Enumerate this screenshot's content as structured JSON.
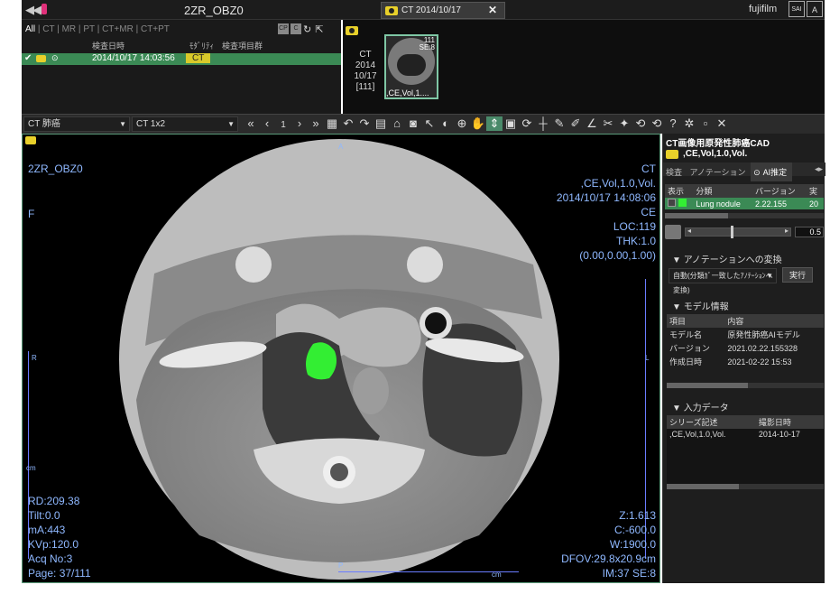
{
  "topbar": {
    "patient_id": "2ZR_OBZ0",
    "study_tab": "CT 2014/10/17",
    "close_glyph": "✕",
    "user": "fujifilm",
    "icon1": "SAI",
    "icon2": "A"
  },
  "study_list": {
    "filters": [
      "All",
      "CT",
      "MR",
      "PT",
      "CT+MR",
      "CT+PT"
    ],
    "headers": {
      "date": "検査日時",
      "modality": "ﾓﾀﾞﾘﾃｨ",
      "exam": "検査項目群"
    },
    "row": {
      "date": "2014/10/17 14:03:56",
      "modality": "CT"
    }
  },
  "series": {
    "info_lines": [
      "CT",
      "2014",
      "10/17",
      "[111]"
    ],
    "thumb_count": "111",
    "thumb_se": "SE:8",
    "thumb_caption": ",CE,Vol,1...."
  },
  "toolbar": {
    "preset": "CT 肺癌",
    "layout": "CT 1x2",
    "page": "1"
  },
  "viewer": {
    "left_top": [
      "2ZR_OBZ0"
    ],
    "left_mid": "F",
    "left_r": "R",
    "left_cm": "cm",
    "top_marker": "A",
    "bottom_marker": "P",
    "right_marker": "L",
    "scale_cm": "cm",
    "right_top": [
      "CT",
      ",CE,Vol,1.0,Vol.",
      "2014/10/17 14:08:06",
      "CE",
      "LOC:119",
      "THK:1.0",
      "(0.00,0.00,1.00)"
    ],
    "left_bottom": [
      "RD:209.38",
      "Tilt:0.0",
      "mA:443",
      "KVp:120.0",
      "Acq No:3",
      "Page: 37/111"
    ],
    "right_bottom": [
      "Z:1.613",
      "C:-600.0",
      "W:1900.0",
      "DFOV:29.8x20.9cm",
      "IM:37 SE:8"
    ]
  },
  "cad_panel": {
    "title": "CT画像用原発性肺癌CAD",
    "series": ",CE,Vol,1.0,Vol.",
    "tabs": [
      "検査",
      "アノテーション",
      "AI推定"
    ],
    "result_headers": [
      "表示",
      "分類",
      "バージョン",
      "実"
    ],
    "result_row": {
      "label": "Lung nodule",
      "version": "2.22.155",
      "extra": "20"
    },
    "threshold": "0.5",
    "annotation_section": "アノテーションへの変換",
    "annotation_option": "自動(分類ｶﾞ一致したｱﾉﾃｰｼｮﾝへ変換)",
    "run_button": "実行",
    "model_section": "モデル情報",
    "model_headers": [
      "項目",
      "内容"
    ],
    "model_rows": [
      {
        "k": "モデル名",
        "v": "原発性肺癌AIモデル"
      },
      {
        "k": "バージョン",
        "v": "2021.02.22.155328"
      },
      {
        "k": "作成日時",
        "v": "2021-02-22 15:53"
      }
    ],
    "input_section": "入力データ",
    "input_headers": [
      "シリーズ記述",
      "撮影日時"
    ],
    "input_row": {
      "desc": ",CE,Vol,1.0,Vol.",
      "date": "2014-10-17"
    }
  },
  "colors": {
    "accent": "#3b8a55",
    "overlay": "#8fb8ff",
    "badge": "#d8c92a",
    "nodule": "#33ee33"
  }
}
